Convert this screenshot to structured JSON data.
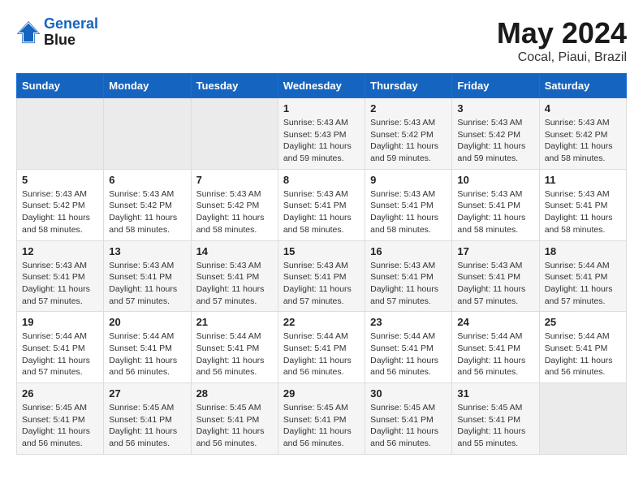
{
  "header": {
    "logo_line1": "General",
    "logo_line2": "Blue",
    "month": "May 2024",
    "location": "Cocal, Piaui, Brazil"
  },
  "weekdays": [
    "Sunday",
    "Monday",
    "Tuesday",
    "Wednesday",
    "Thursday",
    "Friday",
    "Saturday"
  ],
  "weeks": [
    [
      {
        "day": "",
        "info": ""
      },
      {
        "day": "",
        "info": ""
      },
      {
        "day": "",
        "info": ""
      },
      {
        "day": "1",
        "info": "Sunrise: 5:43 AM\nSunset: 5:43 PM\nDaylight: 11 hours\nand 59 minutes."
      },
      {
        "day": "2",
        "info": "Sunrise: 5:43 AM\nSunset: 5:42 PM\nDaylight: 11 hours\nand 59 minutes."
      },
      {
        "day": "3",
        "info": "Sunrise: 5:43 AM\nSunset: 5:42 PM\nDaylight: 11 hours\nand 59 minutes."
      },
      {
        "day": "4",
        "info": "Sunrise: 5:43 AM\nSunset: 5:42 PM\nDaylight: 11 hours\nand 58 minutes."
      }
    ],
    [
      {
        "day": "5",
        "info": "Sunrise: 5:43 AM\nSunset: 5:42 PM\nDaylight: 11 hours\nand 58 minutes."
      },
      {
        "day": "6",
        "info": "Sunrise: 5:43 AM\nSunset: 5:42 PM\nDaylight: 11 hours\nand 58 minutes."
      },
      {
        "day": "7",
        "info": "Sunrise: 5:43 AM\nSunset: 5:42 PM\nDaylight: 11 hours\nand 58 minutes."
      },
      {
        "day": "8",
        "info": "Sunrise: 5:43 AM\nSunset: 5:41 PM\nDaylight: 11 hours\nand 58 minutes."
      },
      {
        "day": "9",
        "info": "Sunrise: 5:43 AM\nSunset: 5:41 PM\nDaylight: 11 hours\nand 58 minutes."
      },
      {
        "day": "10",
        "info": "Sunrise: 5:43 AM\nSunset: 5:41 PM\nDaylight: 11 hours\nand 58 minutes."
      },
      {
        "day": "11",
        "info": "Sunrise: 5:43 AM\nSunset: 5:41 PM\nDaylight: 11 hours\nand 58 minutes."
      }
    ],
    [
      {
        "day": "12",
        "info": "Sunrise: 5:43 AM\nSunset: 5:41 PM\nDaylight: 11 hours\nand 57 minutes."
      },
      {
        "day": "13",
        "info": "Sunrise: 5:43 AM\nSunset: 5:41 PM\nDaylight: 11 hours\nand 57 minutes."
      },
      {
        "day": "14",
        "info": "Sunrise: 5:43 AM\nSunset: 5:41 PM\nDaylight: 11 hours\nand 57 minutes."
      },
      {
        "day": "15",
        "info": "Sunrise: 5:43 AM\nSunset: 5:41 PM\nDaylight: 11 hours\nand 57 minutes."
      },
      {
        "day": "16",
        "info": "Sunrise: 5:43 AM\nSunset: 5:41 PM\nDaylight: 11 hours\nand 57 minutes."
      },
      {
        "day": "17",
        "info": "Sunrise: 5:43 AM\nSunset: 5:41 PM\nDaylight: 11 hours\nand 57 minutes."
      },
      {
        "day": "18",
        "info": "Sunrise: 5:44 AM\nSunset: 5:41 PM\nDaylight: 11 hours\nand 57 minutes."
      }
    ],
    [
      {
        "day": "19",
        "info": "Sunrise: 5:44 AM\nSunset: 5:41 PM\nDaylight: 11 hours\nand 57 minutes."
      },
      {
        "day": "20",
        "info": "Sunrise: 5:44 AM\nSunset: 5:41 PM\nDaylight: 11 hours\nand 56 minutes."
      },
      {
        "day": "21",
        "info": "Sunrise: 5:44 AM\nSunset: 5:41 PM\nDaylight: 11 hours\nand 56 minutes."
      },
      {
        "day": "22",
        "info": "Sunrise: 5:44 AM\nSunset: 5:41 PM\nDaylight: 11 hours\nand 56 minutes."
      },
      {
        "day": "23",
        "info": "Sunrise: 5:44 AM\nSunset: 5:41 PM\nDaylight: 11 hours\nand 56 minutes."
      },
      {
        "day": "24",
        "info": "Sunrise: 5:44 AM\nSunset: 5:41 PM\nDaylight: 11 hours\nand 56 minutes."
      },
      {
        "day": "25",
        "info": "Sunrise: 5:44 AM\nSunset: 5:41 PM\nDaylight: 11 hours\nand 56 minutes."
      }
    ],
    [
      {
        "day": "26",
        "info": "Sunrise: 5:45 AM\nSunset: 5:41 PM\nDaylight: 11 hours\nand 56 minutes."
      },
      {
        "day": "27",
        "info": "Sunrise: 5:45 AM\nSunset: 5:41 PM\nDaylight: 11 hours\nand 56 minutes."
      },
      {
        "day": "28",
        "info": "Sunrise: 5:45 AM\nSunset: 5:41 PM\nDaylight: 11 hours\nand 56 minutes."
      },
      {
        "day": "29",
        "info": "Sunrise: 5:45 AM\nSunset: 5:41 PM\nDaylight: 11 hours\nand 56 minutes."
      },
      {
        "day": "30",
        "info": "Sunrise: 5:45 AM\nSunset: 5:41 PM\nDaylight: 11 hours\nand 56 minutes."
      },
      {
        "day": "31",
        "info": "Sunrise: 5:45 AM\nSunset: 5:41 PM\nDaylight: 11 hours\nand 55 minutes."
      },
      {
        "day": "",
        "info": ""
      }
    ]
  ]
}
